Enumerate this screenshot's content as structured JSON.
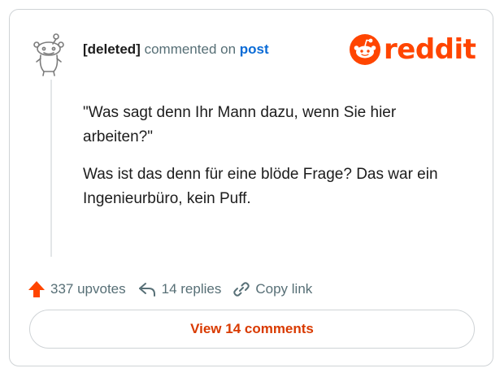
{
  "colors": {
    "brand": "#ff4500",
    "link": "#0a6bd6",
    "muted": "#576f76",
    "text": "#1c1c1c"
  },
  "header": {
    "username": "[deleted]",
    "commented_on": "commented on",
    "post_link": "post",
    "logo_text": "reddit"
  },
  "comment": {
    "paragraphs": [
      "\"Was sagt denn Ihr Mann dazu, wenn Sie hier arbeiten?\"",
      "Was ist das denn für eine blöde Frage? Das war ein Ingenieurbüro, kein Puff."
    ]
  },
  "footer": {
    "upvotes": "337 upvotes",
    "replies": "14 replies",
    "copy_link": "Copy link"
  },
  "view_button": {
    "label": "View 14 comments"
  },
  "icons": {
    "avatar": "deleted-user-snoo-icon",
    "logo": "reddit-snoo-logo-icon",
    "upvote": "upvote-arrow-icon",
    "reply": "reply-arrow-icon",
    "link": "chain-link-icon"
  }
}
